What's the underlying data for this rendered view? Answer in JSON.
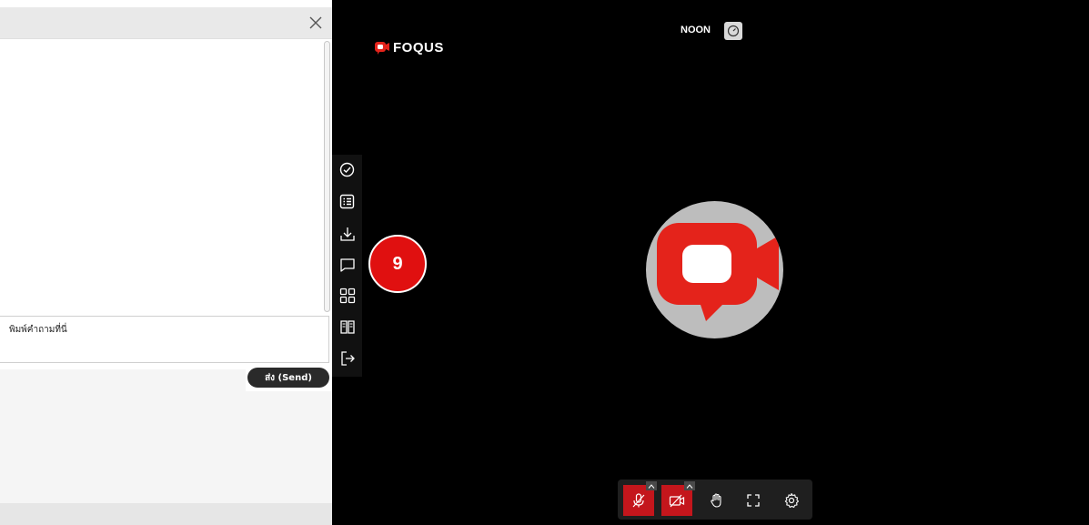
{
  "chat": {
    "input_placeholder": "พิมพ์คำถามที่นี่",
    "send_label": "ส่ง (Send)"
  },
  "stage": {
    "logo_text": "FOQUS",
    "user_name": "NOON",
    "badge_number": "9"
  },
  "colors": {
    "accent_red": "#e01010",
    "control_red": "#c4161c",
    "stage_bg": "#000000",
    "avatar_bg": "#bdbdbd"
  },
  "side_tools": [
    "check-circle-icon",
    "list-icon",
    "download-icon",
    "chat-icon",
    "grid-icon",
    "book-icon",
    "exit-icon"
  ],
  "controls": [
    "mic-off-icon",
    "camera-off-icon",
    "raise-hand-icon",
    "fullscreen-icon",
    "settings-icon"
  ]
}
